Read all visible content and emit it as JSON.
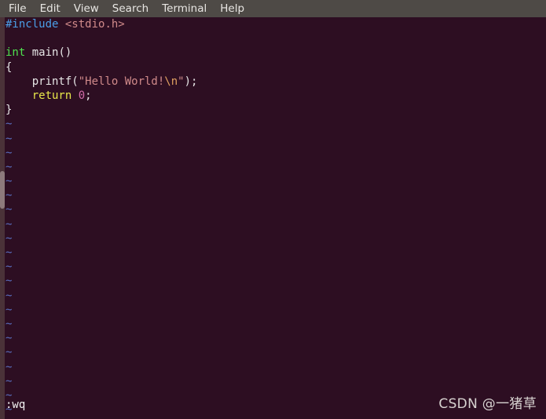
{
  "menubar": {
    "items": [
      {
        "label": "File",
        "name": "menu-file"
      },
      {
        "label": "Edit",
        "name": "menu-edit"
      },
      {
        "label": "View",
        "name": "menu-view"
      },
      {
        "label": "Search",
        "name": "menu-search"
      },
      {
        "label": "Terminal",
        "name": "menu-terminal"
      },
      {
        "label": "Help",
        "name": "menu-help"
      }
    ]
  },
  "editor": {
    "application": "vim",
    "code_lines": [
      {
        "n": 1,
        "tokens": [
          {
            "t": "#include",
            "c": "c-pre"
          },
          {
            "t": " ",
            "c": "c-plain"
          },
          {
            "t": "<stdio.h>",
            "c": "c-header"
          }
        ]
      },
      {
        "n": 2,
        "tokens": []
      },
      {
        "n": 3,
        "tokens": [
          {
            "t": "int",
            "c": "c-type"
          },
          {
            "t": " main()",
            "c": "c-plain"
          }
        ]
      },
      {
        "n": 4,
        "tokens": [
          {
            "t": "{",
            "c": "c-plain"
          }
        ]
      },
      {
        "n": 5,
        "tokens": [
          {
            "t": "    printf(",
            "c": "c-plain"
          },
          {
            "t": "\"Hello World!",
            "c": "c-string"
          },
          {
            "t": "\\n",
            "c": "c-escape"
          },
          {
            "t": "\"",
            "c": "c-string"
          },
          {
            "t": ");",
            "c": "c-plain"
          }
        ]
      },
      {
        "n": 6,
        "tokens": [
          {
            "t": "    ",
            "c": "c-plain"
          },
          {
            "t": "return",
            "c": "c-keyword"
          },
          {
            "t": " ",
            "c": "c-plain"
          },
          {
            "t": "0",
            "c": "c-number"
          },
          {
            "t": ";",
            "c": "c-plain"
          }
        ]
      },
      {
        "n": 7,
        "tokens": [
          {
            "t": "}",
            "c": "c-plain"
          }
        ]
      }
    ],
    "filler_char": "~",
    "filler_count": 21,
    "status_line": ":wq"
  },
  "watermark": {
    "text": "CSDN @一猪草"
  },
  "colors": {
    "menubar_background": "#4e4a46",
    "menubar_text": "#e8e6e3",
    "terminal_background": "#2d0e22",
    "scrollbar_trough": "#4a3238",
    "scrollbar_thumb": "#8d7a7c",
    "preprocessor": "#4b9fe8",
    "header_name": "#d08a8a",
    "type_keyword": "#4ee24e",
    "plain_text": "#e6e6e6",
    "string_literal": "#d08a8a",
    "escape_sequence": "#e0a060",
    "control_keyword": "#e8e84a",
    "number_literal": "#d06aa8",
    "filler_tilde": "#5a6fc0",
    "status_text": "#f2f2f2",
    "watermark_text": "#d7d2d0"
  }
}
